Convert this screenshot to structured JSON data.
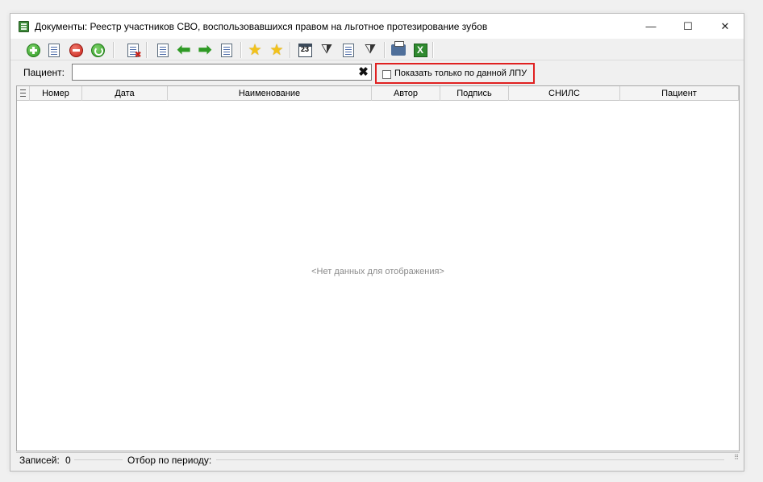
{
  "window": {
    "title": "Документы: Реестр участников СВО, воспользовавшихся правом на льготное протезирование зубов",
    "minimize_glyph": "—",
    "maximize_glyph": "☐",
    "close_glyph": "✕"
  },
  "toolbar": {
    "icons": [
      "add-icon",
      "edit-document-icon",
      "delete-icon",
      "refresh-icon",
      "delete-document-icon",
      "copy-icon",
      "arrow-left-icon",
      "arrow-right-icon",
      "paste-icon",
      "star-add-icon",
      "star-down-icon",
      "calendar-icon",
      "filter-icon",
      "filter-edit-icon",
      "filter-clear-icon",
      "print-icon",
      "excel-icon"
    ],
    "calendar_text": "23",
    "arrow_left": "⬅",
    "arrow_right": "➡",
    "star": "★",
    "funnel": "⧩",
    "excel_text": "X",
    "x_badge": "✖"
  },
  "filter": {
    "patient_label": "Пациент:",
    "patient_value": "",
    "clear_glyph": "✖",
    "lpu_checkbox_label": "Показать только по данной ЛПУ",
    "lpu_checked": false,
    "highlight_color": "#e02020"
  },
  "grid": {
    "columns": [
      "Номер",
      "Дата",
      "Наименование",
      "Автор",
      "Подпись",
      "СНИЛС",
      "Пациент"
    ],
    "rows": [],
    "empty_message": "<Нет данных для отображения>"
  },
  "status": {
    "records_label": "Записей:",
    "records_count": "0",
    "period_label": "Отбор по периоду:",
    "grip": "⠿"
  }
}
